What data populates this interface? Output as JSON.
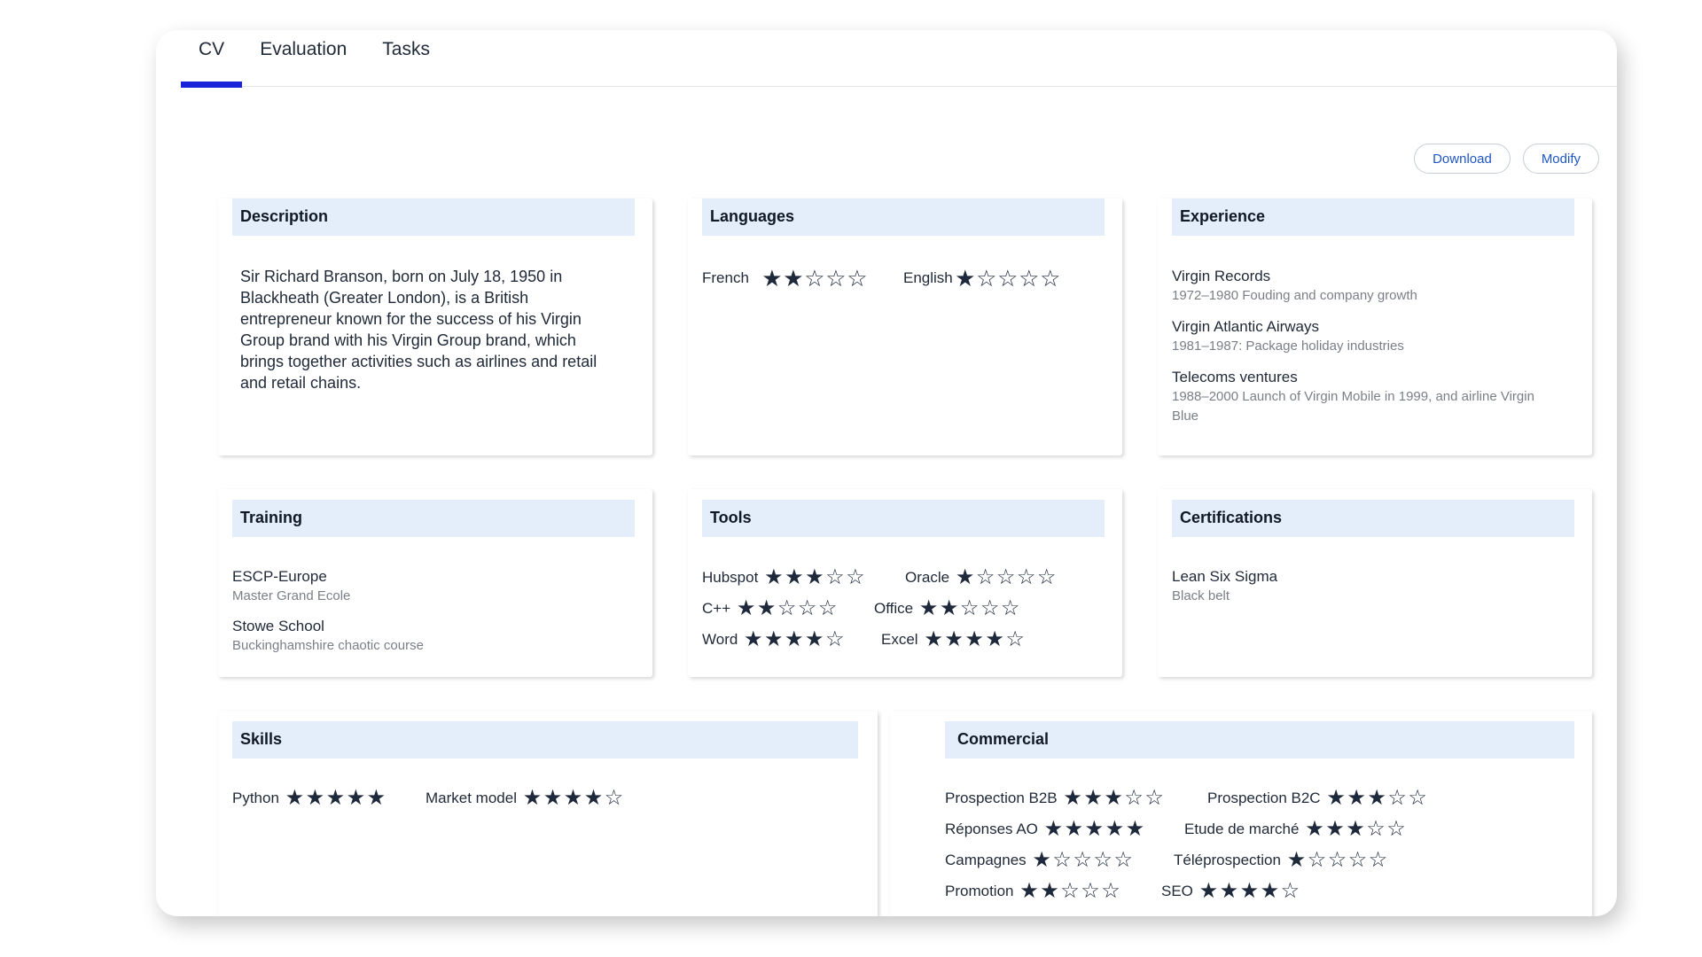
{
  "tabs": [
    {
      "label": "CV",
      "active": true
    },
    {
      "label": "Evaluation",
      "active": false
    },
    {
      "label": "Tasks",
      "active": false
    }
  ],
  "actions": {
    "download": "Download",
    "modify": "Modify"
  },
  "colors": {
    "accent": "#1a23d9",
    "header_bg": "#e3eefa",
    "button_text": "#1f56c2",
    "star": "#1e293b"
  },
  "description": {
    "title": "Description",
    "text": "Sir Richard Branson, born on July 18, 1950 in Blackheath (Greater London), is a British entrepreneur known for the success of his Virgin Group brand with his Virgin Group brand, which brings together activities such as airlines and retail and retail chains."
  },
  "languages": {
    "title": "Languages",
    "items": [
      {
        "name": "French",
        "rating": 2
      },
      {
        "name": "English",
        "rating": 1
      }
    ]
  },
  "experience": {
    "title": "Experience",
    "items": [
      {
        "title": "Virgin Records",
        "sub": "1972–1980 Fouding and company growth"
      },
      {
        "title": "Virgin Atlantic Airways",
        "sub": "1981–1987: Package holiday industries"
      },
      {
        "title": "Telecoms ventures",
        "sub": "1988–2000 Launch of Virgin Mobile in 1999, and airline Virgin Blue"
      }
    ]
  },
  "training": {
    "title": "Training",
    "items": [
      {
        "title": "ESCP-Europe",
        "sub": "Master Grand Ecole"
      },
      {
        "title": "Stowe School",
        "sub": "Buckinghamshire chaotic course"
      }
    ]
  },
  "tools": {
    "title": "Tools",
    "items": [
      {
        "name": "Hubspot",
        "rating": 3
      },
      {
        "name": "Oracle",
        "rating": 1
      },
      {
        "name": "C++",
        "rating": 2
      },
      {
        "name": "Office",
        "rating": 2
      },
      {
        "name": "Word",
        "rating": 4
      },
      {
        "name": "Excel",
        "rating": 4
      }
    ]
  },
  "certifications": {
    "title": "Certifications",
    "items": [
      {
        "title": "Lean Six Sigma",
        "sub": "Black belt"
      }
    ]
  },
  "skills": {
    "title": "Skills",
    "items": [
      {
        "name": "Python",
        "rating": 5
      },
      {
        "name": "Market model",
        "rating": 4
      }
    ]
  },
  "commercial": {
    "title": "Commercial",
    "items": [
      {
        "name": "Prospection B2B",
        "rating": 3
      },
      {
        "name": "Prospection B2C",
        "rating": 3
      },
      {
        "name": "Réponses AO",
        "rating": 5
      },
      {
        "name": "Etude de marché",
        "rating": 3
      },
      {
        "name": "Campagnes",
        "rating": 1
      },
      {
        "name": "Téléprospection",
        "rating": 1
      },
      {
        "name": "Promotion",
        "rating": 2
      },
      {
        "name": "SEO",
        "rating": 4
      }
    ]
  }
}
